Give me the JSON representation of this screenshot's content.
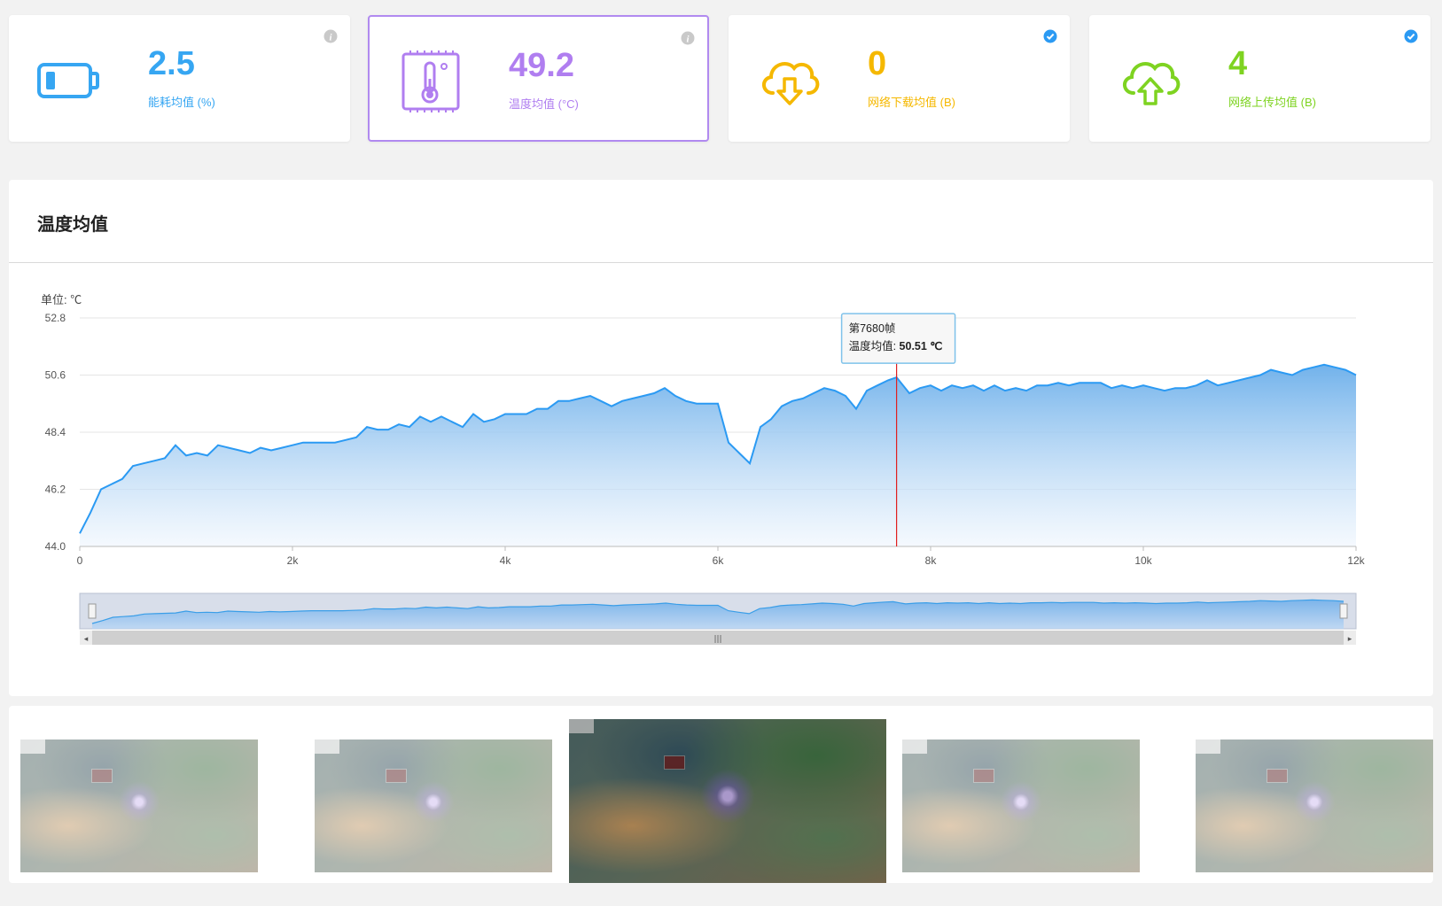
{
  "cards": [
    {
      "value": "2.5",
      "label": "能耗均值 (%)",
      "color": "#36a6f2",
      "icon": "battery-icon",
      "badge": "info-icon"
    },
    {
      "value": "49.2",
      "label": "温度均值 (°C)",
      "color": "#b07ef0",
      "icon": "thermometer-chip-icon",
      "badge": "info-icon"
    },
    {
      "value": "0",
      "label": "网络下载均值 (B)",
      "color": "#f5b800",
      "icon": "cloud-download-icon",
      "badge": "check-circle-icon"
    },
    {
      "value": "4",
      "label": "网络上传均值 (B)",
      "color": "#7ed321",
      "icon": "cloud-upload-icon",
      "badge": "check-circle-icon"
    }
  ],
  "chart": {
    "panel_title": "温度均值",
    "unit_label": "单位: ℃"
  },
  "chart_data": {
    "type": "area",
    "title": "温度均值",
    "ylabel": "单位: ℃",
    "xlabel": "",
    "ylim": [
      44.0,
      52.8
    ],
    "xlim": [
      0,
      12000
    ],
    "y_ticks": [
      "44.0",
      "46.2",
      "48.4",
      "50.6",
      "52.8"
    ],
    "x_ticks": [
      "0",
      "2k",
      "4k",
      "6k",
      "8k",
      "10k",
      "12k"
    ],
    "grid": true,
    "color": "#3a9ee8",
    "series": [
      {
        "x": [
          0,
          100,
          200,
          300,
          400,
          500,
          600,
          700,
          800,
          900,
          1000,
          1100,
          1200,
          1300,
          1400,
          1500,
          1600,
          1700,
          1800,
          1900,
          2000,
          2100,
          2200,
          2300,
          2400,
          2500,
          2600,
          2700,
          2800,
          2900,
          3000,
          3100,
          3200,
          3300,
          3400,
          3500,
          3600,
          3700,
          3800,
          3900,
          4000,
          4100,
          4200,
          4300,
          4400,
          4500,
          4600,
          4700,
          4800,
          4900,
          5000,
          5100,
          5200,
          5300,
          5400,
          5500,
          5600,
          5700,
          5800,
          5900,
          6000,
          6100,
          6200,
          6300,
          6400,
          6500,
          6600,
          6700,
          6800,
          6900,
          7000,
          7100,
          7200,
          7300,
          7400,
          7500,
          7600,
          7680,
          7800,
          7900,
          8000,
          8100,
          8200,
          8300,
          8400,
          8500,
          8600,
          8700,
          8800,
          8900,
          9000,
          9100,
          9200,
          9300,
          9400,
          9500,
          9600,
          9700,
          9800,
          9900,
          10000,
          10100,
          10200,
          10300,
          10400,
          10500,
          10600,
          10700,
          10800,
          10900,
          11000,
          11100,
          11200,
          11300,
          11400,
          11500,
          11600,
          11700,
          11800,
          11900,
          12000
        ],
        "values": [
          44.5,
          45.3,
          46.2,
          46.4,
          46.6,
          47.1,
          47.2,
          47.3,
          47.4,
          47.9,
          47.5,
          47.6,
          47.5,
          47.9,
          47.8,
          47.7,
          47.6,
          47.8,
          47.7,
          47.8,
          47.9,
          48.0,
          48.0,
          48.0,
          48.0,
          48.1,
          48.2,
          48.6,
          48.5,
          48.5,
          48.7,
          48.6,
          49.0,
          48.8,
          49.0,
          48.8,
          48.6,
          49.1,
          48.8,
          48.9,
          49.1,
          49.1,
          49.1,
          49.3,
          49.3,
          49.6,
          49.6,
          49.7,
          49.8,
          49.6,
          49.4,
          49.6,
          49.7,
          49.8,
          49.9,
          50.1,
          49.8,
          49.6,
          49.5,
          49.5,
          49.5,
          48.0,
          47.6,
          47.2,
          48.6,
          48.9,
          49.4,
          49.6,
          49.7,
          49.9,
          50.1,
          50.0,
          49.8,
          49.3,
          50.0,
          50.2,
          50.4,
          50.51,
          49.9,
          50.1,
          50.2,
          50.0,
          50.2,
          50.1,
          50.2,
          50.0,
          50.2,
          50.0,
          50.1,
          50.0,
          50.2,
          50.2,
          50.3,
          50.2,
          50.3,
          50.3,
          50.3,
          50.1,
          50.2,
          50.1,
          50.2,
          50.1,
          50.0,
          50.1,
          50.1,
          50.2,
          50.4,
          50.2,
          50.3,
          50.4,
          50.5,
          50.6,
          50.8,
          50.7,
          50.6,
          50.8,
          50.9,
          51.0,
          50.9,
          50.8,
          50.6
        ]
      }
    ],
    "tooltip": {
      "frame": "第7680帧",
      "label": "温度均值",
      "value": "50.51 ℃",
      "x": 7680,
      "y": 50.51
    }
  },
  "frames": {
    "count": 5,
    "selected_index": 2
  }
}
